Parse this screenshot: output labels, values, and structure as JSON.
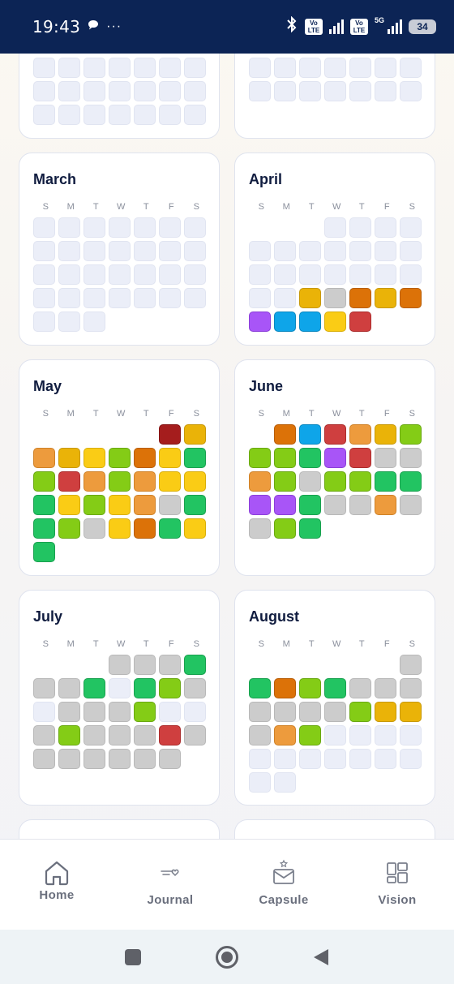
{
  "status": {
    "time": "19:43",
    "battery": "34",
    "volte1": "Vo LTE",
    "volte2": "Vo LTE",
    "net": "5G"
  },
  "palette": {
    "blank": "#ebeef8",
    "gray": "#cccccc",
    "dgreen": "#22c462",
    "lgreen": "#84cc16",
    "yellow": "#facc15",
    "gold": "#eab308",
    "lorange": "#ed9b3d",
    "orange": "#dc7208",
    "red": "#cf3f3f",
    "dred": "#a51d1d",
    "purple": "#a855f7",
    "blue": "#0ea5e9"
  },
  "weekdays": [
    "S",
    "M",
    "T",
    "W",
    "T",
    "F",
    "S"
  ],
  "months": [
    {
      "key": "jan",
      "title": "",
      "cells": [
        "blank",
        "blank",
        "blank",
        "blank",
        "blank",
        "blank",
        "blank",
        "blank",
        "blank",
        "blank",
        "blank",
        "blank",
        "blank",
        "blank",
        "blank",
        "blank",
        "blank",
        "blank",
        "blank",
        "blank",
        "blank"
      ]
    },
    {
      "key": "feb",
      "title": "",
      "cells": [
        "blank",
        "blank",
        "blank",
        "blank",
        "blank",
        "blank",
        "blank",
        "blank",
        "blank",
        "blank",
        "blank",
        "blank",
        "blank",
        "blank"
      ]
    },
    {
      "key": "march",
      "title": "March",
      "cells": [
        "blank",
        "blank",
        "blank",
        "blank",
        "blank",
        "blank",
        "blank",
        "blank",
        "blank",
        "blank",
        "blank",
        "blank",
        "blank",
        "blank",
        "blank",
        "blank",
        "blank",
        "blank",
        "blank",
        "blank",
        "blank",
        "blank",
        "blank",
        "blank",
        "blank",
        "blank",
        "blank",
        "blank",
        "blank",
        "blank",
        "blank"
      ]
    },
    {
      "key": "april",
      "title": "April",
      "cells": [
        "empty",
        "empty",
        "empty",
        "blank",
        "blank",
        "blank",
        "blank",
        "blank",
        "blank",
        "blank",
        "blank",
        "blank",
        "blank",
        "blank",
        "blank",
        "blank",
        "blank",
        "blank",
        "blank",
        "blank",
        "blank",
        "blank",
        "blank",
        "gold",
        "gray",
        "orange",
        "gold",
        "orange",
        "purple",
        "blue",
        "blue",
        "yellow",
        "red"
      ]
    },
    {
      "key": "may",
      "title": "May",
      "cells": [
        "empty",
        "empty",
        "empty",
        "empty",
        "empty",
        "dred",
        "gold",
        "lorange",
        "gold",
        "yellow",
        "lgreen",
        "orange",
        "yellow",
        "dgreen",
        "lgreen",
        "red",
        "lorange",
        "lgreen",
        "lorange",
        "yellow",
        "yellow",
        "dgreen",
        "yellow",
        "lgreen",
        "yellow",
        "lorange",
        "gray",
        "dgreen",
        "dgreen",
        "lgreen",
        "gray",
        "yellow",
        "orange",
        "dgreen",
        "yellow",
        "dgreen"
      ]
    },
    {
      "key": "june",
      "title": "June",
      "cells": [
        "empty",
        "orange",
        "blue",
        "red",
        "lorange",
        "gold",
        "lgreen",
        "lgreen",
        "lgreen",
        "dgreen",
        "purple",
        "red",
        "gray",
        "gray",
        "lorange",
        "lgreen",
        "gray",
        "lgreen",
        "lgreen",
        "dgreen",
        "dgreen",
        "purple",
        "purple",
        "dgreen",
        "gray",
        "gray",
        "lorange",
        "gray",
        "gray",
        "lgreen",
        "dgreen"
      ]
    },
    {
      "key": "july",
      "title": "July",
      "cells": [
        "empty",
        "empty",
        "empty",
        "gray",
        "gray",
        "gray",
        "dgreen",
        "gray",
        "gray",
        "dgreen",
        "blank",
        "dgreen",
        "lgreen",
        "gray",
        "blank",
        "gray",
        "gray",
        "gray",
        "lgreen",
        "blank",
        "blank",
        "gray",
        "lgreen",
        "gray",
        "gray",
        "gray",
        "red",
        "gray",
        "gray",
        "gray",
        "gray",
        "gray",
        "gray",
        "gray"
      ]
    },
    {
      "key": "august",
      "title": "August",
      "cells": [
        "empty",
        "empty",
        "empty",
        "empty",
        "empty",
        "empty",
        "gray",
        "dgreen",
        "orange",
        "lgreen",
        "dgreen",
        "gray",
        "gray",
        "gray",
        "gray",
        "gray",
        "gray",
        "gray",
        "lgreen",
        "gold",
        "gold",
        "gray",
        "lorange",
        "lgreen",
        "blank",
        "blank",
        "blank",
        "blank",
        "blank",
        "blank",
        "blank",
        "blank",
        "blank",
        "blank",
        "blank",
        "blank",
        "blank"
      ]
    }
  ],
  "nav": {
    "home": "Home",
    "journal": "Journal",
    "capsule": "Capsule",
    "vision": "Vision"
  }
}
